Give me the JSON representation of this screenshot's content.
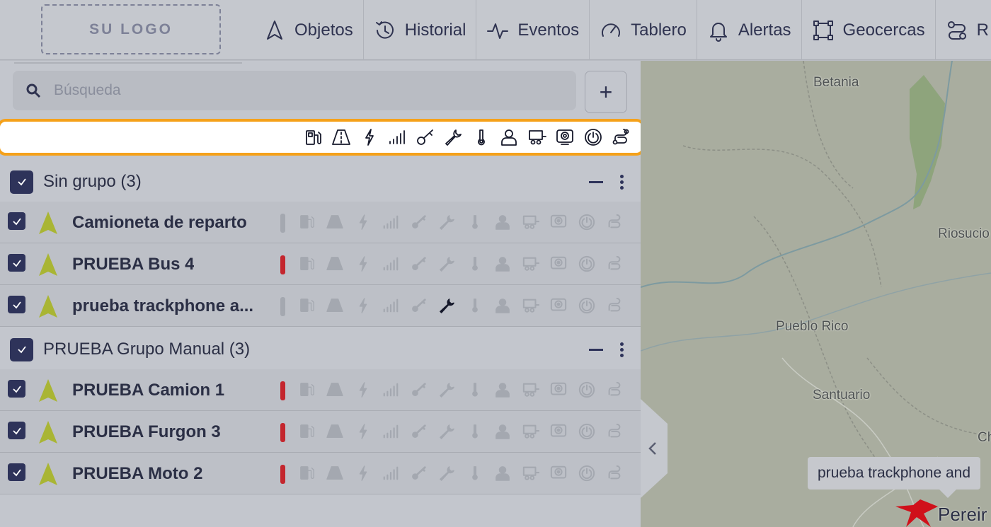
{
  "logo": "SU LOGO",
  "nav": [
    {
      "label": "Objetos",
      "icon": "navigation-icon"
    },
    {
      "label": "Historial",
      "icon": "history-icon"
    },
    {
      "label": "Eventos",
      "icon": "activity-icon"
    },
    {
      "label": "Tablero",
      "icon": "gauge-icon"
    },
    {
      "label": "Alertas",
      "icon": "bell-icon"
    },
    {
      "label": "Geocercas",
      "icon": "geofence-icon"
    },
    {
      "label": "R",
      "icon": "route-icon"
    }
  ],
  "search": {
    "placeholder": "Búsqueda",
    "value": "",
    "add_label": "+"
  },
  "filter_icons": [
    "fuel-icon",
    "road-icon",
    "power-icon",
    "signal-icon",
    "key-icon",
    "wrench-icon",
    "thermometer-icon",
    "driver-icon",
    "trailer-icon",
    "camera-icon",
    "ignition-icon",
    "route-icon"
  ],
  "groups": [
    {
      "label": "Sin grupo (3)",
      "objects": [
        {
          "name": "Camioneta de reparto",
          "status": "gray",
          "active_icon": ""
        },
        {
          "name": "PRUEBA Bus 4",
          "status": "red",
          "active_icon": ""
        },
        {
          "name": "prueba trackphone a...",
          "status": "gray",
          "active_icon": "wrench-icon"
        }
      ]
    },
    {
      "label": "PRUEBA Grupo Manual (3)",
      "objects": [
        {
          "name": "PRUEBA Camion 1",
          "status": "red",
          "active_icon": ""
        },
        {
          "name": "PRUEBA Furgon 3",
          "status": "red",
          "active_icon": ""
        },
        {
          "name": "PRUEBA Moto 2",
          "status": "red",
          "active_icon": ""
        }
      ]
    }
  ],
  "map": {
    "labels": [
      "Betania",
      "Riosucio",
      "Pueblo Rico",
      "Santuario",
      "Ch",
      "Pereir"
    ],
    "tooltip": "prueba trackphone and"
  },
  "colors": {
    "accent": "#f5a11a",
    "checkbox": "#2e335a",
    "status_red": "#c4262e",
    "status_gray": "#a4a8b0",
    "arrow": "#a9b534",
    "marker": "#d0101a"
  }
}
